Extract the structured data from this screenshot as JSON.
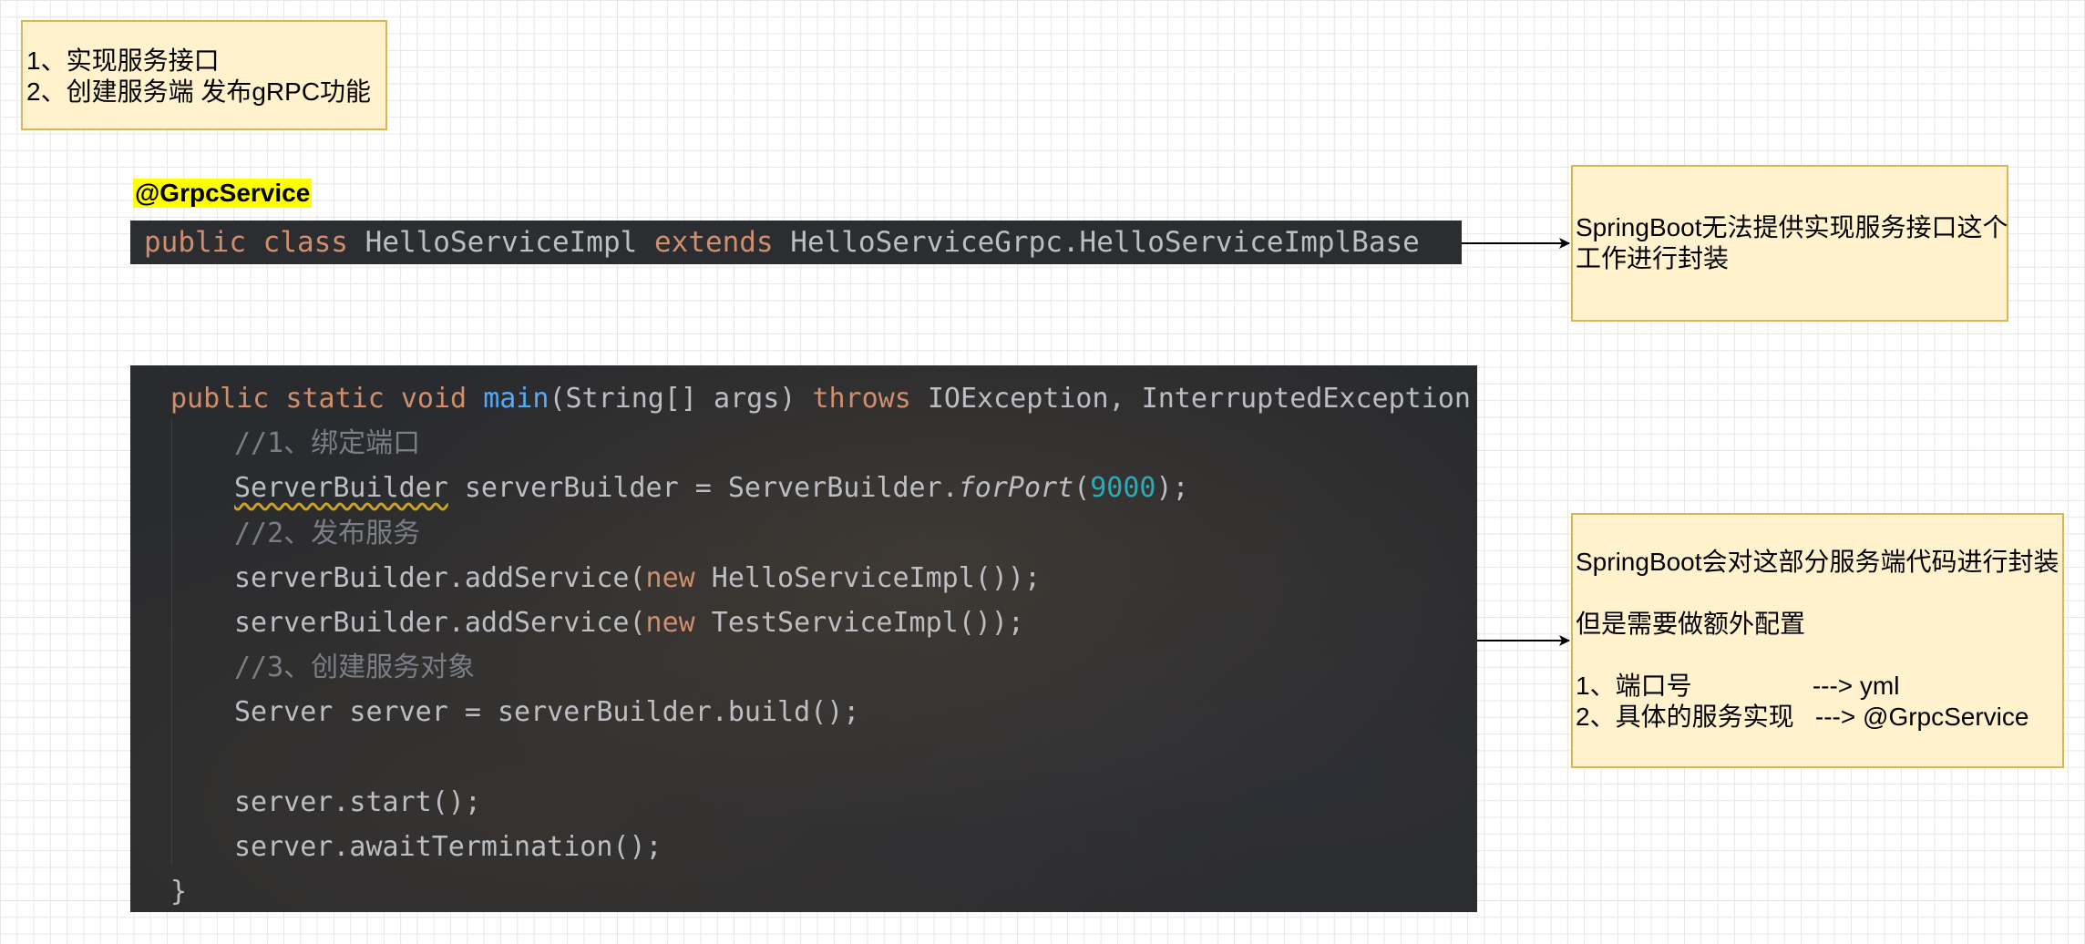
{
  "note_top_left": {
    "lines": [
      "1、实现服务接口",
      "2、创建服务端 发布gRPC功能"
    ]
  },
  "annotation_label": "@GrpcService",
  "class_declaration": {
    "public": "public",
    "class": "class",
    "name": "HelloServiceImpl",
    "extends": "extends",
    "base": "HelloServiceGrpc.HelloServiceImplBase"
  },
  "main_code": {
    "sig_public": "public",
    "sig_static": "static",
    "sig_void": "void",
    "sig_name": "main",
    "sig_params": "(String[] args)",
    "sig_throws": "throws",
    "sig_exceptions": "IOException, InterruptedException {",
    "comment_1": "//1、绑定端口",
    "line2_type": "ServerBuilder",
    "line2_mid": " serverBuilder = ServerBuilder.",
    "line2_method": "forPort",
    "line2_open": "(",
    "line2_num": "9000",
    "line2_close": ");",
    "comment_2": "//2、发布服务",
    "line4_pre": "serverBuilder.addService(",
    "line4_new": "new",
    "line4_post": " HelloServiceImpl());",
    "line5_pre": "serverBuilder.addService(",
    "line5_new": "new",
    "line5_post": " TestServiceImpl());",
    "comment_3": "//3、创建服务对象",
    "line7": "Server server = serverBuilder.build();",
    "line9": "server.start();",
    "line10": "server.awaitTermination();",
    "close_brace": "}"
  },
  "note_right_1": {
    "lines": [
      "SpringBoot无法提供实现服务接口这个",
      "工作进行封装"
    ]
  },
  "note_right_2": {
    "lines": [
      "SpringBoot会对这部分服务端代码进行封装",
      "",
      "但是需要做额外配置",
      "",
      "1、端口号                 ---> yml",
      "2、具体的服务实现   ---> @GrpcService"
    ]
  },
  "colors": {
    "note_fill": "#fff2cc",
    "note_border": "#d6b656",
    "label_highlight": "#ffff00",
    "code_bg": "#2b2d30",
    "keyword": "#cf8e6d",
    "function": "#56a8f5",
    "comment": "#7a7e85",
    "number": "#2aacb8"
  }
}
